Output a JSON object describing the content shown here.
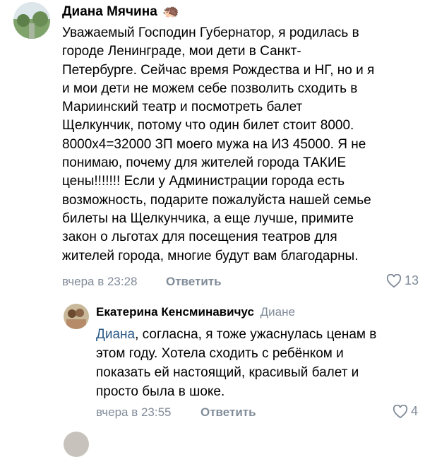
{
  "comment": {
    "author": "Диана Мячина",
    "author_emoji": "🦔",
    "text": "Уважаемый Господин Губернатор, я родилась в\nгороде Ленинграде, мои дети в Санкт-\nПетербурге. Сейчас время Рождества и НГ, но и я\nи мои дети не можем себе позволить сходить в\nМариинский театр и посмотреть балет\nЩелкунчик, потому что один билет стоит 8000.\n8000х4=32000 ЗП моего мужа на ИЗ 45000. Я не\nпонимаю, почему для жителей города ТАКИЕ\nцены!!!!!!! Если у Администрации города есть\nвозможность, подарите пожалуйста нашей семье\nбилеты на Щелкунчика, а еще лучше, примите\nзакон о льготах для посещения театров для\nжителей города, многие будут вам благодарны.",
    "time": "вчера в 23:28",
    "reply_label": "Ответить",
    "likes": "13"
  },
  "reply": {
    "author": "Екатерина Кенсминавичус",
    "addressee": "Диане",
    "mention": "Диана",
    "text_after_mention": ", согласна, я тоже ужаснулась ценам в\nэтом году. Хотела сходить с ребёнком и\nпоказать ей настоящий, красивый балет и\nпросто была в шоке.",
    "time": "вчера в 23:55",
    "reply_label": "Ответить",
    "likes": "4"
  },
  "colors": {
    "meta_gray": "#818c99",
    "link_blue": "#2a5885"
  }
}
